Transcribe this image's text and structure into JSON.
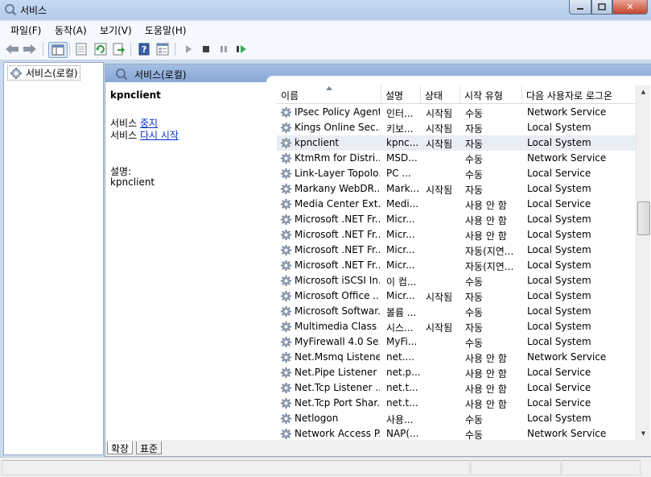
{
  "window": {
    "title": "서비스"
  },
  "menu": [
    "파일(F)",
    "동작(A)",
    "보기(V)",
    "도움말(H)"
  ],
  "tree": {
    "root_label": "서비스(로컬)"
  },
  "panel": {
    "header_title": "서비스(로컬)"
  },
  "extended": {
    "service_name": "kpnclient",
    "action_prefix_1": "서비스 ",
    "action_link_1": "중지",
    "action_prefix_2": "서비스 ",
    "action_link_2": "다시 시작",
    "desc_label": "설명:",
    "desc_value": "kpnclient"
  },
  "columns": [
    "이름",
    "설명",
    "상태",
    "시작 유형",
    "다음 사용자로 로그온"
  ],
  "rows": [
    {
      "name": "IPsec Policy Agent",
      "desc": "인터...",
      "status": "시작됨",
      "startup": "수동",
      "logon": "Network Service"
    },
    {
      "name": "Kings Online Sec...",
      "desc": "키보...",
      "status": "시작됨",
      "startup": "자동",
      "logon": "Local System"
    },
    {
      "name": "kpnclient",
      "desc": "kpnc...",
      "status": "시작됨",
      "startup": "자동",
      "logon": "Local System",
      "selected": true
    },
    {
      "name": "KtmRm for Distri...",
      "desc": "MSD...",
      "status": "",
      "startup": "수동",
      "logon": "Network Service"
    },
    {
      "name": "Link-Layer Topolo...",
      "desc": "PC ...",
      "status": "",
      "startup": "수동",
      "logon": "Local Service"
    },
    {
      "name": "Markany WebDR...",
      "desc": "Mark...",
      "status": "시작됨",
      "startup": "자동",
      "logon": "Local System"
    },
    {
      "name": "Media Center Ext...",
      "desc": "Medi...",
      "status": "",
      "startup": "사용 안 함",
      "logon": "Local Service"
    },
    {
      "name": "Microsoft .NET Fr...",
      "desc": "Micr...",
      "status": "",
      "startup": "사용 안 함",
      "logon": "Local System"
    },
    {
      "name": "Microsoft .NET Fr...",
      "desc": "Micr...",
      "status": "",
      "startup": "사용 안 함",
      "logon": "Local System"
    },
    {
      "name": "Microsoft .NET Fr...",
      "desc": "Micr...",
      "status": "",
      "startup": "자동(지연...",
      "logon": "Local System"
    },
    {
      "name": "Microsoft .NET Fr...",
      "desc": "Micr...",
      "status": "",
      "startup": "자동(지연...",
      "logon": "Local System"
    },
    {
      "name": "Microsoft iSCSI In...",
      "desc": "이 컴...",
      "status": "",
      "startup": "수동",
      "logon": "Local System"
    },
    {
      "name": "Microsoft Office ...",
      "desc": "Micr...",
      "status": "시작됨",
      "startup": "자동",
      "logon": "Local System"
    },
    {
      "name": "Microsoft Softwar...",
      "desc": "볼륨 ...",
      "status": "",
      "startup": "수동",
      "logon": "Local System"
    },
    {
      "name": "Multimedia Class ...",
      "desc": "시스...",
      "status": "시작됨",
      "startup": "자동",
      "logon": "Local System"
    },
    {
      "name": "MyFirewall 4.0 Se...",
      "desc": "MyFi...",
      "status": "",
      "startup": "수동",
      "logon": "Local System"
    },
    {
      "name": "Net.Msmq Listene...",
      "desc": "net....",
      "status": "",
      "startup": "사용 안 함",
      "logon": "Network Service"
    },
    {
      "name": "Net.Pipe Listener ...",
      "desc": "net.p...",
      "status": "",
      "startup": "사용 안 함",
      "logon": "Local Service"
    },
    {
      "name": "Net.Tcp Listener ...",
      "desc": "net.t...",
      "status": "",
      "startup": "사용 안 함",
      "logon": "Local Service"
    },
    {
      "name": "Net.Tcp Port Shar...",
      "desc": "net.t...",
      "status": "",
      "startup": "사용 안 함",
      "logon": "Local Service"
    },
    {
      "name": "Netlogon",
      "desc": "사용...",
      "status": "",
      "startup": "수동",
      "logon": "Local System"
    },
    {
      "name": "Network Access P...",
      "desc": "NAP(...",
      "status": "",
      "startup": "수동",
      "logon": "Network Service"
    }
  ],
  "tabs": [
    "확장",
    "표준"
  ]
}
